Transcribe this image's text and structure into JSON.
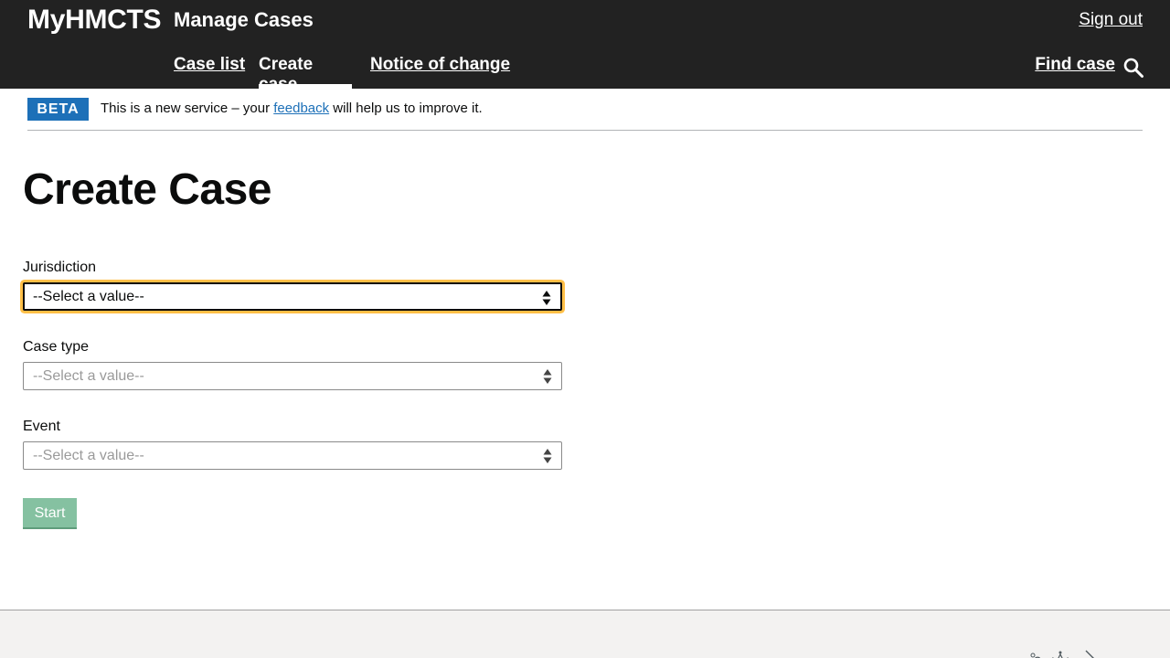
{
  "header": {
    "brand": "MyHMCTS",
    "service_name": "Manage Cases",
    "sign_out": "Sign out",
    "nav": [
      {
        "label": "Case list"
      },
      {
        "label": "Create case"
      },
      {
        "label": "Notice of change"
      }
    ],
    "find_case": "Find case",
    "search_icon": "search-icon"
  },
  "beta": {
    "tag": "BETA",
    "text_before": "This is a new service – your ",
    "link": "feedback",
    "text_after": " will help us to improve it."
  },
  "page": {
    "title": "Create Case"
  },
  "form": {
    "jurisdiction": {
      "label": "Jurisdiction",
      "value": "--Select a value--"
    },
    "case_type": {
      "label": "Case type",
      "value": "--Select a value--"
    },
    "event": {
      "label": "Event",
      "value": "--Select a value--"
    },
    "start": "Start"
  },
  "footer": {
    "crest_icon": "royal-crest-icon"
  },
  "colors": {
    "header_bg": "#222222",
    "beta_tag": "#1d70b8",
    "focus": "#ffbf47",
    "start_disabled": "#85c1a1",
    "footer_bg": "#f3f2f1"
  }
}
